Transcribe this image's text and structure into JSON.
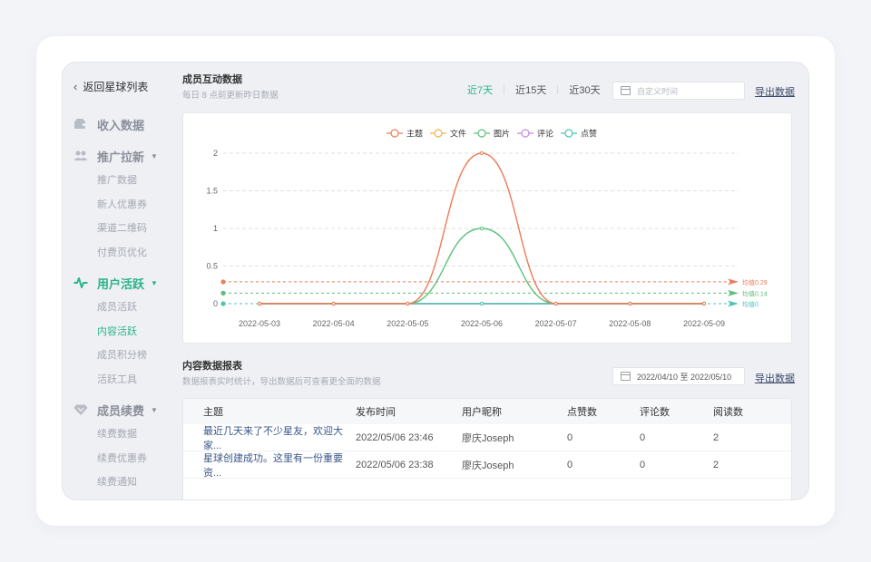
{
  "sidebar": {
    "back_label": "返回星球列表",
    "groups": [
      {
        "label": "收入数据",
        "icon": "wallet-icon",
        "items": []
      },
      {
        "label": "推广拉新",
        "icon": "users-icon",
        "items": [
          "推广数据",
          "新人优惠券",
          "渠道二维码",
          "付费页优化"
        ]
      },
      {
        "label": "用户活跃",
        "icon": "pulse-icon",
        "active": true,
        "items": [
          "成员活跃",
          "内容活跃",
          "成员积分榜",
          "活跃工具"
        ],
        "active_item": "内容活跃"
      },
      {
        "label": "成员续费",
        "icon": "diamond-icon",
        "items": [
          "续费数据",
          "续费优惠券",
          "续费通知"
        ]
      }
    ]
  },
  "interaction": {
    "title": "成员互动数据",
    "subtitle": "每日 8 点前更新昨日数据",
    "tabs": [
      "近7天",
      "近15天",
      "近30天"
    ],
    "active_tab": "近7天",
    "date_placeholder": "自定义时间",
    "export_label": "导出数据"
  },
  "chart_data": {
    "type": "line",
    "legend": [
      "主题",
      "文件",
      "图片",
      "评论",
      "点赞"
    ],
    "colors": {
      "主题": "#ee7b58",
      "文件": "#f3b04a",
      "图片": "#5cc07c",
      "评论": "#c08ae6",
      "点赞": "#4cc4b4"
    },
    "categories": [
      "2022-05-03",
      "2022-05-04",
      "2022-05-05",
      "2022-05-06",
      "2022-05-07",
      "2022-05-08",
      "2022-05-09"
    ],
    "series": [
      {
        "name": "主题",
        "values": [
          0,
          0,
          0,
          2,
          0,
          0,
          0
        ]
      },
      {
        "name": "文件",
        "values": [
          0,
          0,
          0,
          0,
          0,
          0,
          0
        ]
      },
      {
        "name": "图片",
        "values": [
          0,
          0,
          0,
          1,
          0,
          0,
          0
        ]
      },
      {
        "name": "评论",
        "values": [
          0,
          0,
          0,
          0,
          0,
          0,
          0
        ]
      },
      {
        "name": "点赞",
        "values": [
          0,
          0,
          0,
          0,
          0,
          0,
          0
        ]
      }
    ],
    "yticks": [
      "0",
      "0.5",
      "1",
      "1.5",
      "2"
    ],
    "ylim": [
      0,
      2
    ],
    "averages": [
      {
        "label": "均值0.29",
        "value": 0.29,
        "color": "#ee7b58"
      },
      {
        "label": "均值0.14",
        "value": 0.14,
        "color": "#5cc07c"
      },
      {
        "label": "均值0",
        "value": 0,
        "color": "#4cc4b4"
      }
    ]
  },
  "report": {
    "title": "内容数据报表",
    "subtitle": "数据报表实时统计，导出数据后可查看更全面的数据",
    "date_range": "2022/04/10 至 2022/05/10",
    "export_label": "导出数据",
    "columns": [
      "主题",
      "发布时间",
      "用户昵称",
      "点赞数",
      "评论数",
      "阅读数"
    ],
    "rows": [
      [
        "最近几天来了不少星友，欢迎大家...",
        "2022/05/06 23:46",
        "廖庆Joseph",
        "0",
        "0",
        "2"
      ],
      [
        "星球创建成功。这里有一份重要资...",
        "2022/05/06 23:38",
        "廖庆Joseph",
        "0",
        "0",
        "2"
      ]
    ]
  }
}
